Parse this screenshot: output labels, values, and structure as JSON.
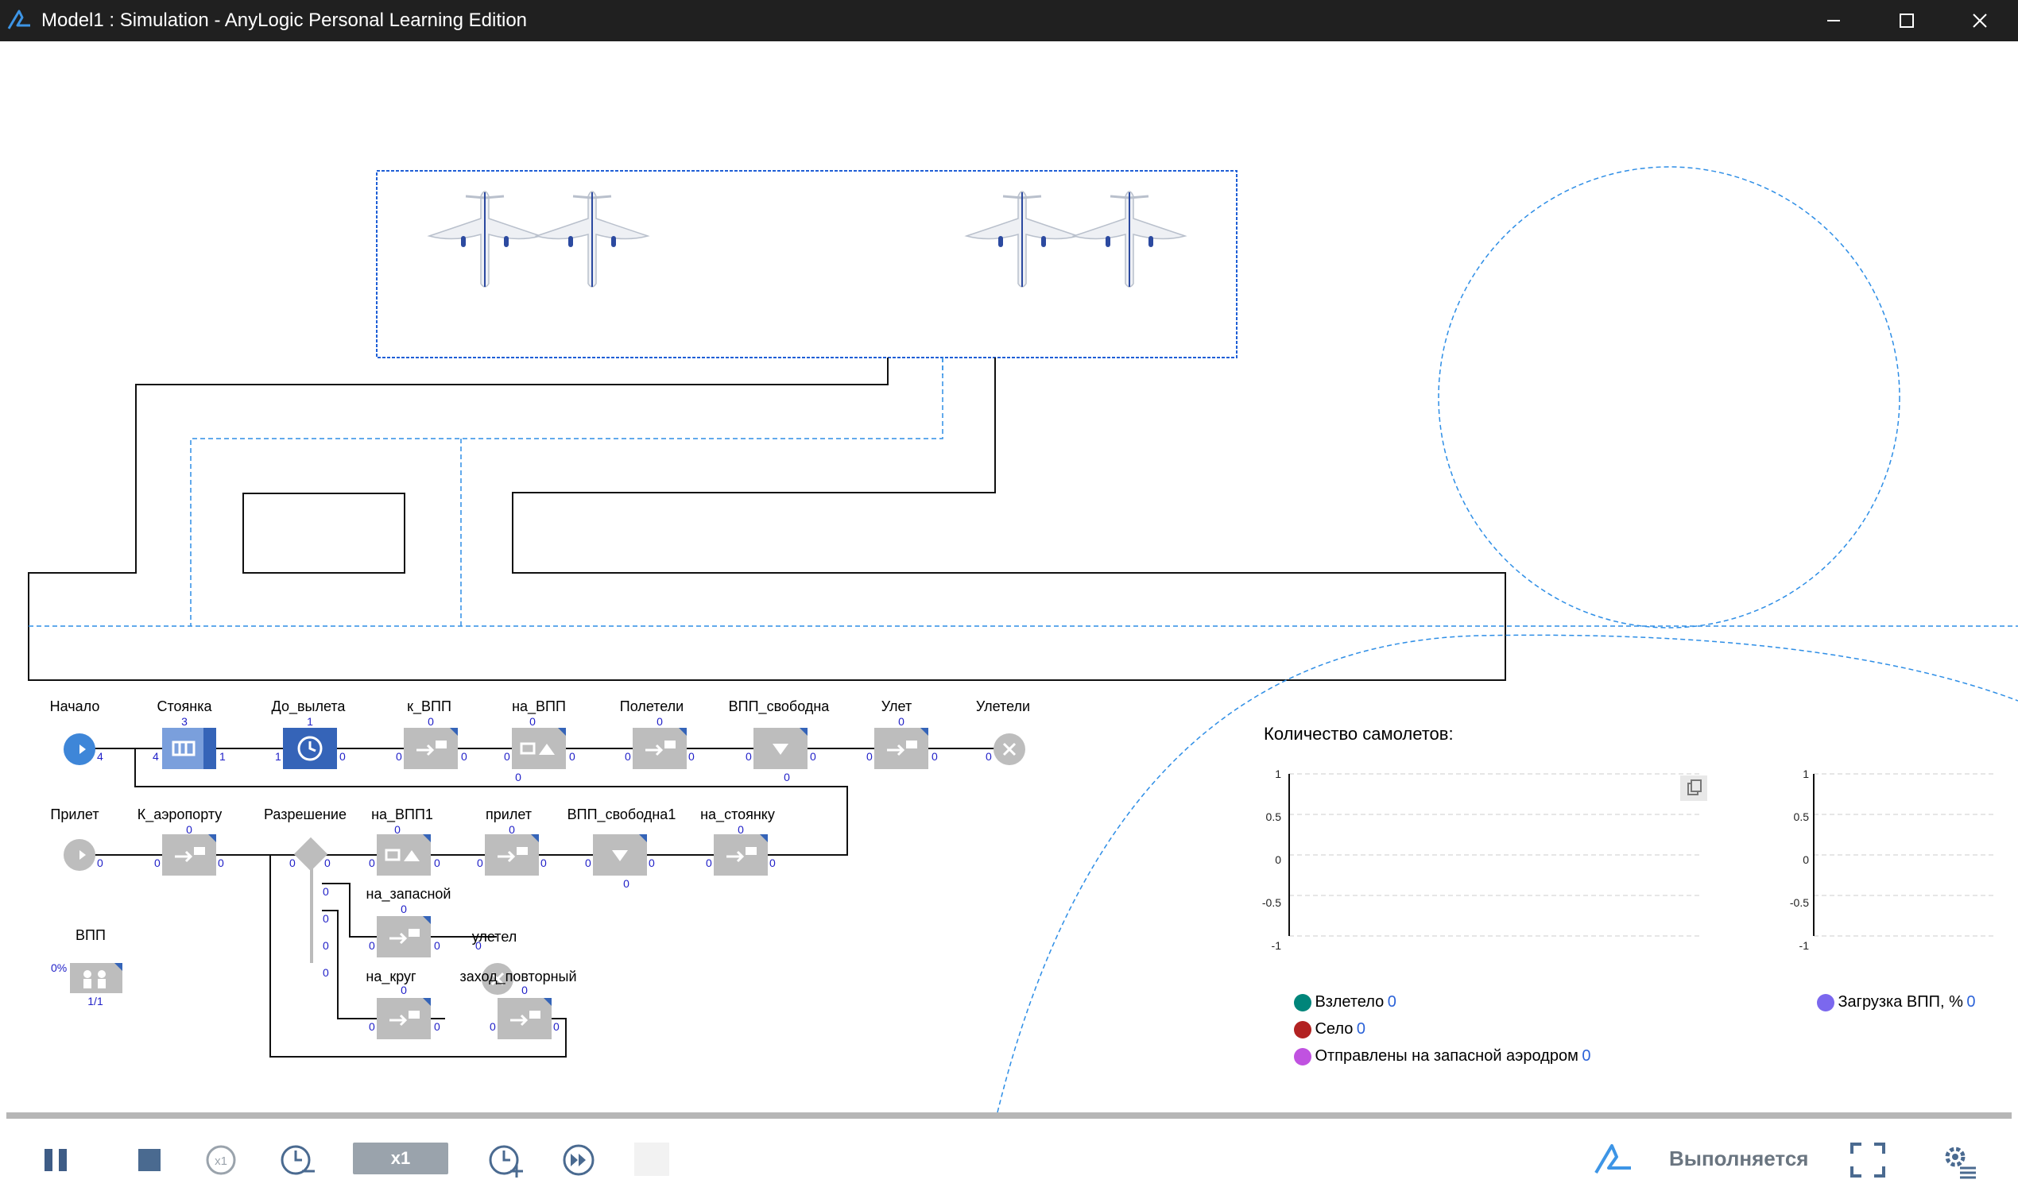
{
  "window": {
    "title": "Model1 : Simulation - AnyLogic Personal Learning Edition"
  },
  "flowchart": {
    "row1": [
      {
        "name": "Начало",
        "left": "",
        "right": "4",
        "top": ""
      },
      {
        "name": "Стоянка",
        "left": "4",
        "right": "1",
        "top": "3"
      },
      {
        "name": "До_вылета",
        "left": "1",
        "right": "0",
        "top": "1"
      },
      {
        "name": "к_ВПП",
        "left": "0",
        "right": "0",
        "top": "0"
      },
      {
        "name": "на_ВПП",
        "left": "0",
        "right": "0",
        "top": "0",
        "bottom": "0"
      },
      {
        "name": "Полетели",
        "left": "0",
        "right": "0",
        "top": "0"
      },
      {
        "name": "ВПП_свободна",
        "left": "0",
        "right": "0",
        "top": "",
        "bottom": "0"
      },
      {
        "name": "Улет",
        "left": "0",
        "right": "0",
        "top": "0"
      },
      {
        "name": "Улетели",
        "left": "0",
        "right": "",
        "top": ""
      }
    ],
    "row2": [
      {
        "name": "Прилет",
        "left": "",
        "right": "0",
        "top": ""
      },
      {
        "name": "К_аэропорту",
        "left": "0",
        "right": "0",
        "top": "0"
      },
      {
        "name": "Разрешение",
        "left": "0",
        "right": "0",
        "top": ""
      },
      {
        "name": "на_ВПП1",
        "left": "0",
        "right": "0",
        "top": "0"
      },
      {
        "name": "прилет",
        "left": "0",
        "right": "0",
        "top": "0"
      },
      {
        "name": "ВПП_свободна1",
        "left": "0",
        "right": "0",
        "top": "",
        "bottom": "0"
      },
      {
        "name": "на_стоянку",
        "left": "0",
        "right": "0",
        "top": "0"
      }
    ],
    "select_outputs": [
      "0",
      "0",
      "0",
      "0"
    ],
    "branch": [
      {
        "name": "на_запасной",
        "left": "0",
        "right": "0",
        "top": "0"
      },
      {
        "name": "улетел",
        "left": "0",
        "right": "",
        "top": ""
      },
      {
        "name": "на_круг",
        "left": "0",
        "right": "0",
        "top": "0"
      },
      {
        "name": "заход_повторный",
        "left": "0",
        "right": "0",
        "top": "0"
      }
    ],
    "resource": {
      "name": "ВПП",
      "utilization": "0%",
      "capacity": "1/1"
    }
  },
  "chart": {
    "title": "Количество самолетов:",
    "left_axis": [
      "1",
      "0.5",
      "0",
      "-0.5",
      "-1"
    ],
    "right_axis": [
      "1",
      "0.5",
      "0",
      "-0.5",
      "-1"
    ],
    "legend": [
      {
        "label": "Взлетело",
        "value": "0",
        "color": "#00857a"
      },
      {
        "label": "Село",
        "value": "0",
        "color": "#b22222"
      },
      {
        "label": "Отправлены на запасной аэродром",
        "value": "0",
        "color": "#c052e0"
      }
    ],
    "legend_right": {
      "label": "Загрузка ВПП, %",
      "value": "0",
      "color": "#7b68ee"
    }
  },
  "chart_data": {
    "type": "line",
    "title": "Количество самолетов:",
    "xlabel": "",
    "ylabel": "",
    "ylim": [
      -1,
      1
    ],
    "series": [
      {
        "name": "Взлетело",
        "values": [
          0
        ]
      },
      {
        "name": "Село",
        "values": [
          0
        ]
      },
      {
        "name": "Отправлены на запасной аэродром",
        "values": [
          0
        ]
      },
      {
        "name": "Загрузка ВПП, %",
        "values": [
          0
        ]
      }
    ],
    "grid": true,
    "legend": "bottom"
  },
  "statusbar": {
    "speed": "x1",
    "status": "Выполняется"
  },
  "colors": {
    "accent": "#2b7fd8",
    "path_blue": "#2e8ee6",
    "block_gray": "#bdbdbd",
    "block_blue": "#3564b8",
    "block_lightblue": "#7a9fdc"
  }
}
